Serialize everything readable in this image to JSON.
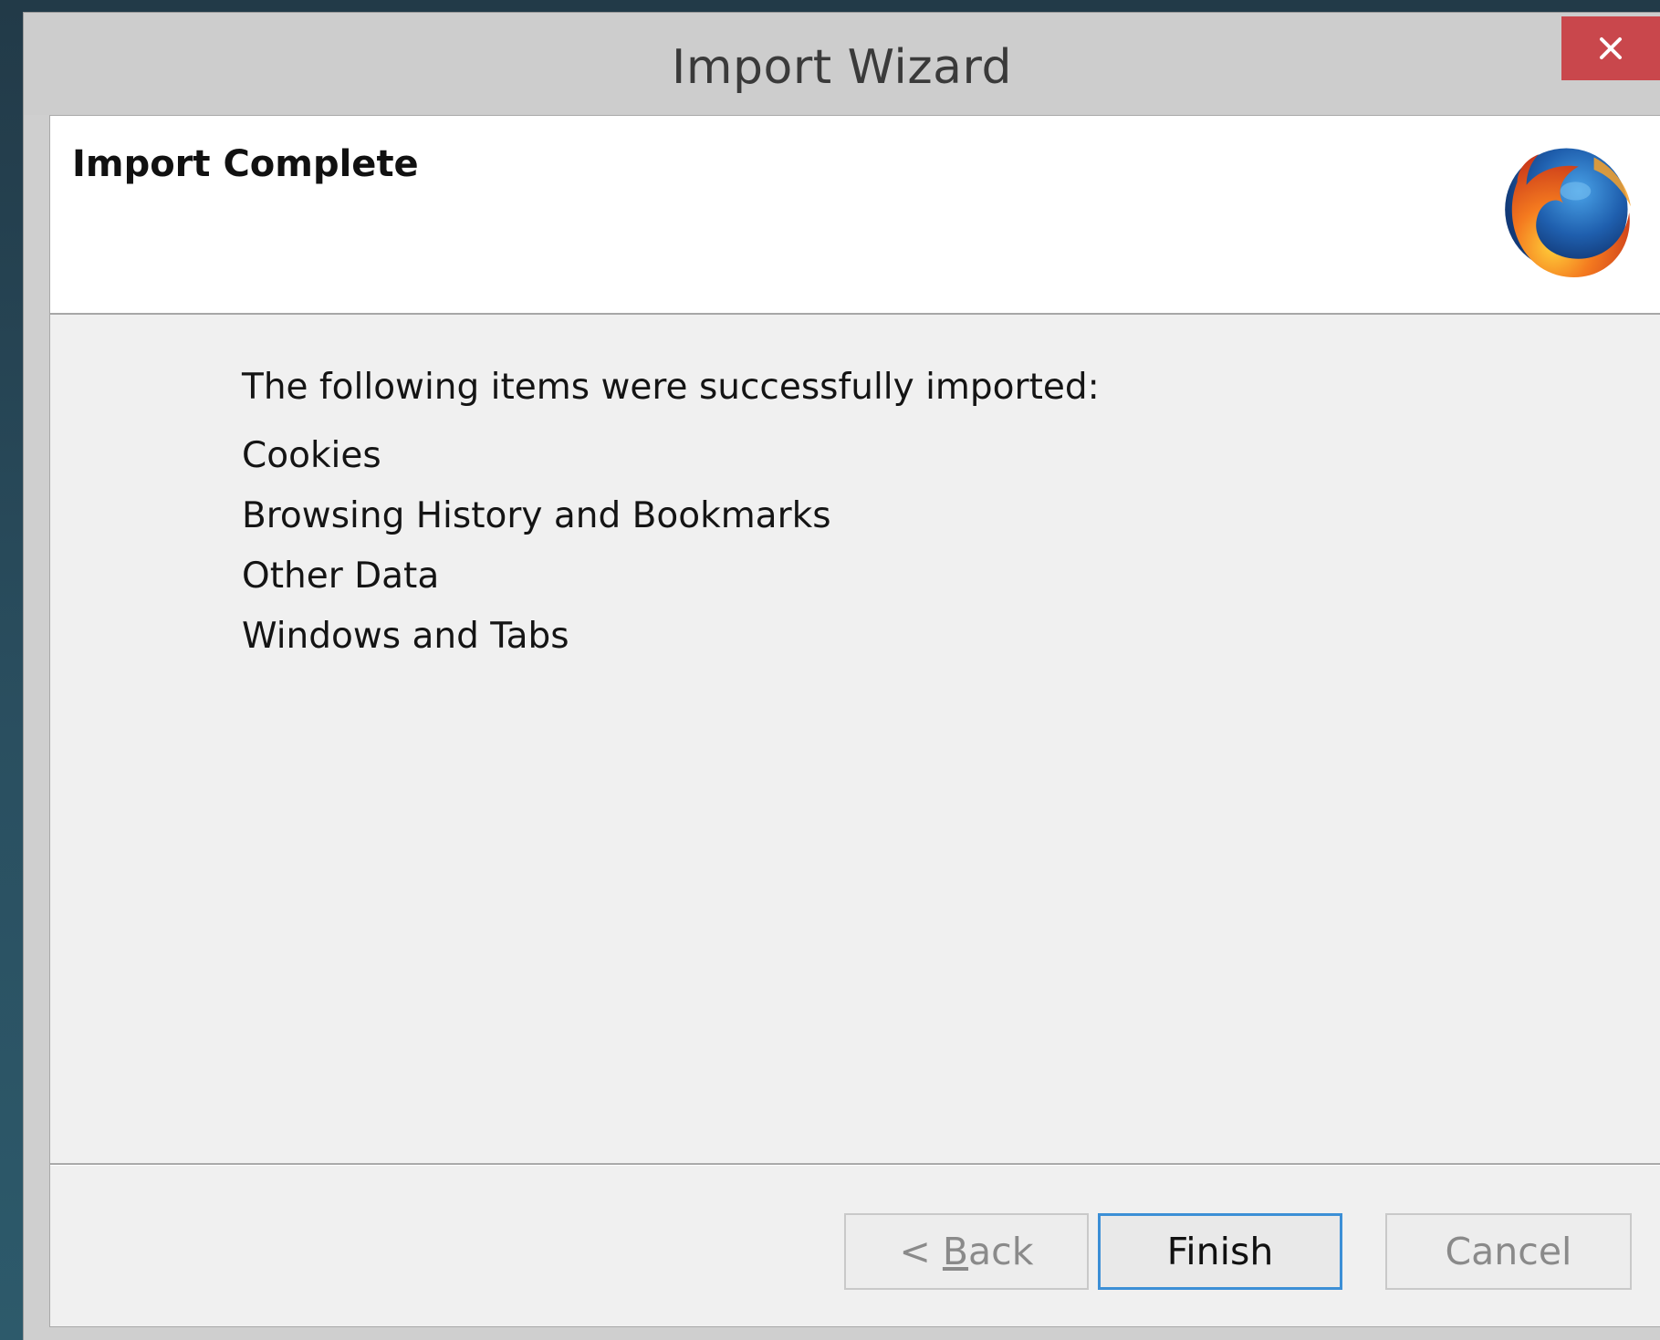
{
  "window": {
    "title": "Import Wizard",
    "close_icon": "close-icon"
  },
  "header": {
    "title": "Import Complete",
    "logo_icon": "firefox-logo-icon"
  },
  "content": {
    "intro": "The following items were successfully imported:",
    "items": [
      "Cookies",
      "Browsing History and Bookmarks",
      "Other Data",
      "Windows and Tabs"
    ]
  },
  "buttons": {
    "back_prefix": "< ",
    "back_access_key": "B",
    "back_rest": "ack",
    "finish": "Finish",
    "cancel": "Cancel"
  },
  "colors": {
    "close_button": "#c9474c",
    "default_button_border": "#3c8fd6",
    "dialog_body": "#f0f0f0"
  }
}
